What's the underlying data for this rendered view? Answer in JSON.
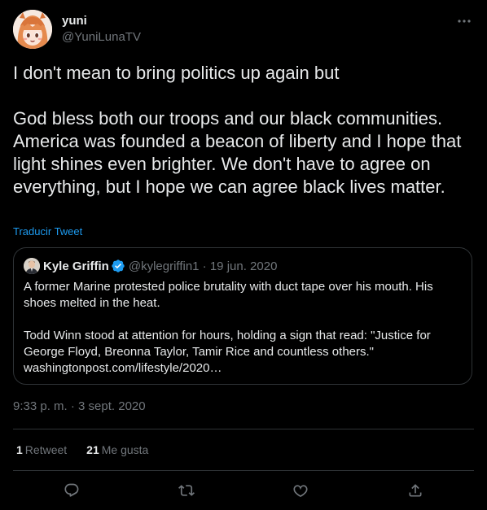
{
  "author": {
    "display_name": "yuni",
    "handle": "@YuniLunaTV",
    "avatar_icon": "anime-avatar-icon"
  },
  "tweet": {
    "paragraphs": [
      "I don't mean to bring politics up again but",
      "God bless both our troops and our black communities. America was founded a beacon of liberty and I hope that light shines even brighter. We don't have to agree on everything, but I hope we can agree black lives matter."
    ],
    "translate_label": "Traducir Tweet",
    "timestamp": "9:33 p. m. · 3 sept. 2020"
  },
  "quote": {
    "display_name": "Kyle Griffin",
    "handle_date": "@kylegriffin1 · 19 jun. 2020",
    "verified_icon": "verified-badge-icon",
    "paragraphs": [
      "A former Marine protested police brutality with duct tape over his mouth. His shoes melted in the heat.",
      "Todd Winn stood at attention for hours, holding a sign that read: \"Justice for George Floyd, Breonna Taylor, Tamir Rice and countless others.\" washingtonpost.com/lifestyle/2020…"
    ]
  },
  "stats": {
    "retweets_count": "1",
    "retweets_label": "Retweet",
    "likes_count": "21",
    "likes_label": "Me gusta"
  },
  "actions": {
    "reply_icon": "reply-icon",
    "retweet_icon": "retweet-icon",
    "like_icon": "heart-icon",
    "share_icon": "share-icon",
    "more_icon": "more-options-icon"
  },
  "colors": {
    "background": "#000000",
    "text": "#e7e9ea",
    "secondary": "#71767b",
    "accent": "#1d9bf0",
    "border": "#2f3336"
  }
}
